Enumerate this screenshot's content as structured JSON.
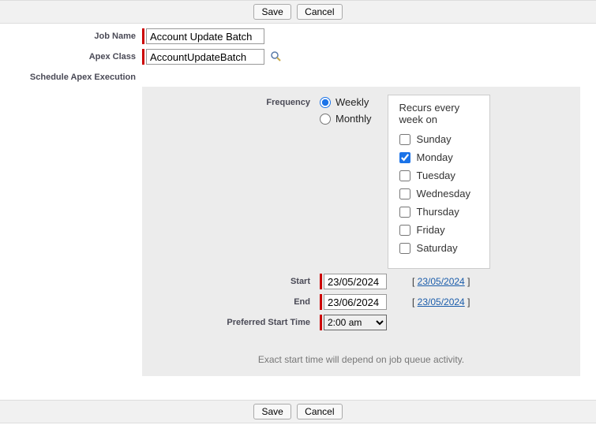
{
  "buttons": {
    "save": "Save",
    "cancel": "Cancel"
  },
  "labels": {
    "jobName": "Job Name",
    "apexClass": "Apex Class",
    "scheduleExec": "Schedule Apex Execution",
    "frequency": "Frequency",
    "start": "Start",
    "end": "End",
    "preferredStartTime": "Preferred Start Time"
  },
  "values": {
    "jobName": "Account Update Batch",
    "apexClass": "AccountUpdateBatch",
    "startDate": "23/05/2024",
    "endDate": "23/06/2024",
    "todayLink": "23/05/2024",
    "preferredTime": "2:00 am"
  },
  "frequency": {
    "weekly": "Weekly",
    "monthly": "Monthly",
    "selected": "weekly"
  },
  "recur": {
    "title": "Recurs every week on",
    "days": [
      {
        "label": "Sunday",
        "checked": false
      },
      {
        "label": "Monday",
        "checked": true
      },
      {
        "label": "Tuesday",
        "checked": false
      },
      {
        "label": "Wednesday",
        "checked": false
      },
      {
        "label": "Thursday",
        "checked": false
      },
      {
        "label": "Friday",
        "checked": false
      },
      {
        "label": "Saturday",
        "checked": false
      }
    ]
  },
  "note": "Exact start time will depend on job queue activity."
}
